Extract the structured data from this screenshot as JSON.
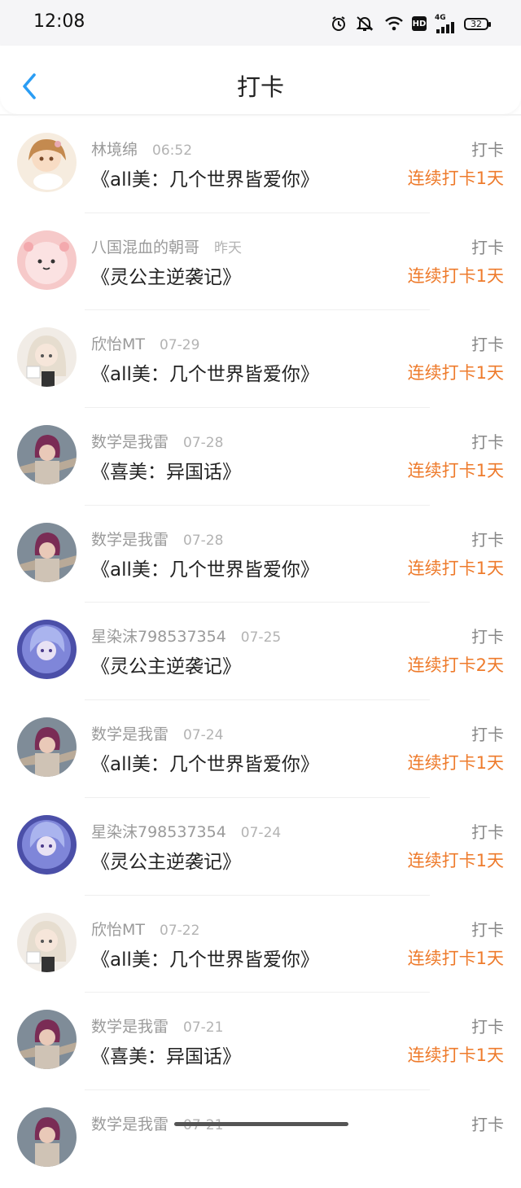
{
  "status_bar": {
    "time": "12:08",
    "icons": [
      "alarm-icon",
      "mute-icon",
      "wifi-icon",
      "hd-icon",
      "signal-icon",
      "battery-icon"
    ],
    "hd_label": "HD",
    "network_label": "4G",
    "battery": "32"
  },
  "header": {
    "title": "打卡",
    "back_icon": "chevron-left-icon"
  },
  "colors": {
    "accent_blue": "#2a9df4",
    "streak_orange": "#ee7b2c",
    "muted_text": "#9a9a9a"
  },
  "items": [
    {
      "user": "林境绵",
      "time": "06:52",
      "title": "《all美：几个世界皆爱你》",
      "action": "打卡",
      "streak": "连续打卡1天",
      "avatar": "anime-girl-avatar"
    },
    {
      "user": "八国混血的朝哥",
      "time": "昨天",
      "title": "《灵公主逆袭记》",
      "action": "打卡",
      "streak": "连续打卡1天",
      "avatar": "pink-blob-avatar"
    },
    {
      "user": "欣怡MT",
      "time": "07-29",
      "title": "《all美：几个世界皆爱你》",
      "action": "打卡",
      "streak": "连续打卡1天",
      "avatar": "white-hair-girl-avatar"
    },
    {
      "user": "数学是我雷",
      "time": "07-28",
      "title": "《喜美：异国话》",
      "action": "打卡",
      "streak": "连续打卡1天",
      "avatar": "purple-hair-character-avatar"
    },
    {
      "user": "数学是我雷",
      "time": "07-28",
      "title": "《all美：几个世界皆爱你》",
      "action": "打卡",
      "streak": "连续打卡1天",
      "avatar": "purple-hair-character-avatar"
    },
    {
      "user": "星染沫798537354",
      "time": "07-25",
      "title": "《灵公主逆袭记》",
      "action": "打卡",
      "streak": "连续打卡2天",
      "avatar": "blue-fairy-avatar"
    },
    {
      "user": "数学是我雷",
      "time": "07-24",
      "title": "《all美：几个世界皆爱你》",
      "action": "打卡",
      "streak": "连续打卡1天",
      "avatar": "purple-hair-character-avatar"
    },
    {
      "user": "星染沫798537354",
      "time": "07-24",
      "title": "《灵公主逆袭记》",
      "action": "打卡",
      "streak": "连续打卡1天",
      "avatar": "blue-fairy-avatar"
    },
    {
      "user": "欣怡MT",
      "time": "07-22",
      "title": "《all美：几个世界皆爱你》",
      "action": "打卡",
      "streak": "连续打卡1天",
      "avatar": "white-hair-girl-avatar"
    },
    {
      "user": "数学是我雷",
      "time": "07-21",
      "title": "《喜美：异国话》",
      "action": "打卡",
      "streak": "连续打卡1天",
      "avatar": "purple-hair-character-avatar"
    },
    {
      "user": "数学是我雷",
      "time": "07-21",
      "title": "",
      "action": "打卡",
      "streak": "",
      "avatar": "purple-hair-character-avatar"
    }
  ]
}
